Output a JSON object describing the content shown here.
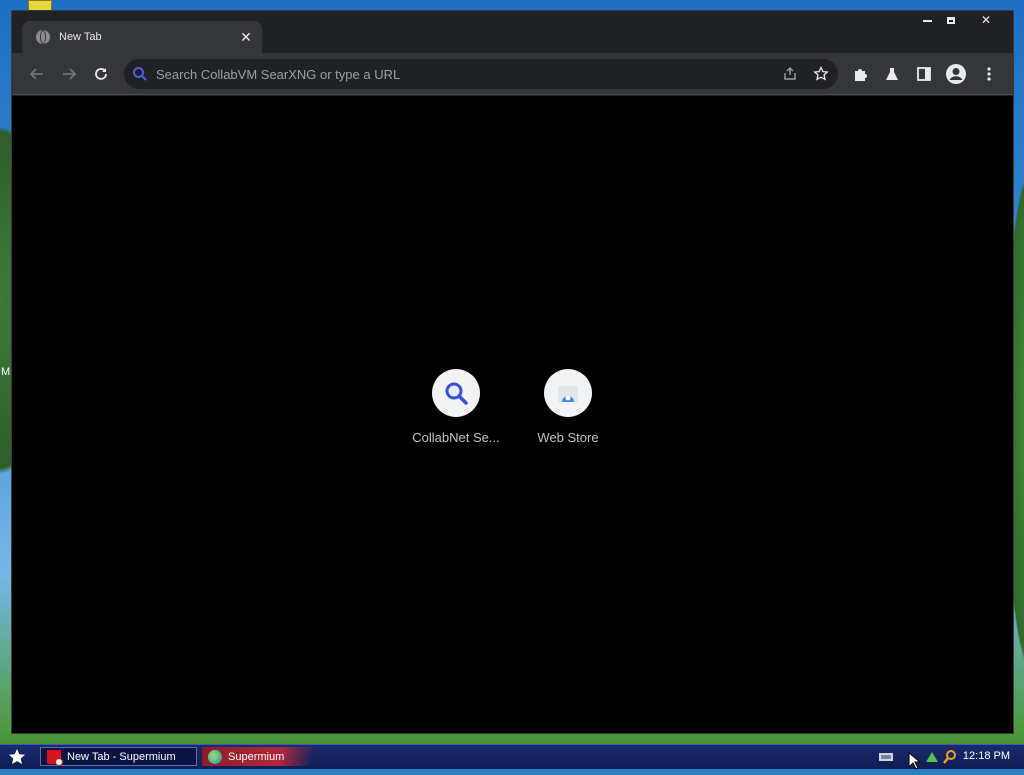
{
  "window": {
    "tab_title": "New Tab",
    "omnibox_placeholder": "Search CollabVM SearXNG or type a URL"
  },
  "shortcuts": [
    {
      "label": "CollabNet Se...",
      "icon": "search-icon",
      "color": "#3c4fd6"
    },
    {
      "label": "Web Store",
      "icon": "web-store-icon",
      "color": "#4285f4"
    }
  ],
  "taskbar": {
    "items": [
      {
        "label": "New Tab - Supermium",
        "active": true
      },
      {
        "label": "Supermium",
        "active": false
      }
    ],
    "clock": "12:18 PM"
  },
  "desktop": {
    "edge_letter": "M"
  },
  "colors": {
    "accent": "#8ab4f8",
    "search_icon": "#4c5fe0",
    "taskbar": "#1a2a6c"
  }
}
